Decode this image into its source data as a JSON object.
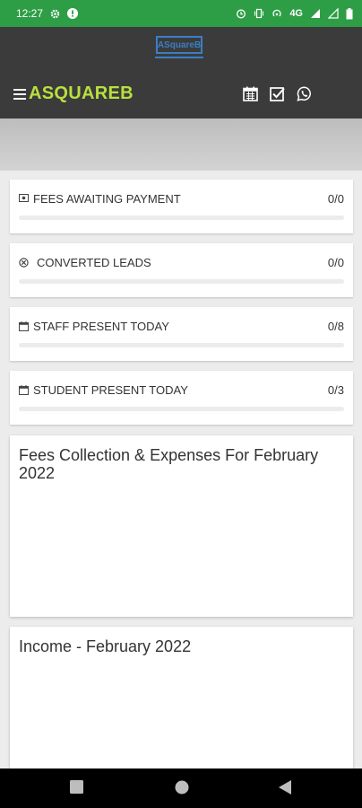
{
  "status_bar": {
    "time": "12:27",
    "network": "4G",
    "icons": [
      "settings-icon",
      "alert-icon",
      "alarm-icon",
      "vibrate-icon",
      "hotspot-icon",
      "signal-icon",
      "wifi-icon",
      "battery-icon"
    ]
  },
  "header": {
    "logo_text": "ASquareB",
    "title": "ASQUAREB",
    "icons": [
      "menu-icon",
      "calendar-icon",
      "checkbox-icon",
      "whatsapp-icon"
    ]
  },
  "stats": [
    {
      "label": "FEES AWAITING PAYMENT",
      "value": "0/0",
      "icon": "money-icon",
      "progress": 0
    },
    {
      "label": "CONVERTED LEADS",
      "value": "0/0",
      "icon": "target-icon",
      "progress": 0
    },
    {
      "label": "STAFF PRESENT TODAY",
      "value": "0/8",
      "icon": "calendar-icon",
      "progress": 0
    },
    {
      "label": "STUDENT PRESENT TODAY",
      "value": "0/3",
      "icon": "calendar-icon",
      "progress": 0
    }
  ],
  "panels": [
    {
      "title": "Fees Collection & Expenses For February 2022"
    },
    {
      "title": "Income - February 2022"
    }
  ],
  "colors": {
    "status_bar": "#2e9e46",
    "header_bg": "#3b3b3b",
    "accent_title": "#b9e03e",
    "logo": "#3a7fc4"
  },
  "nav_bar": {
    "buttons": [
      "recents-button",
      "home-button",
      "back-button"
    ]
  }
}
